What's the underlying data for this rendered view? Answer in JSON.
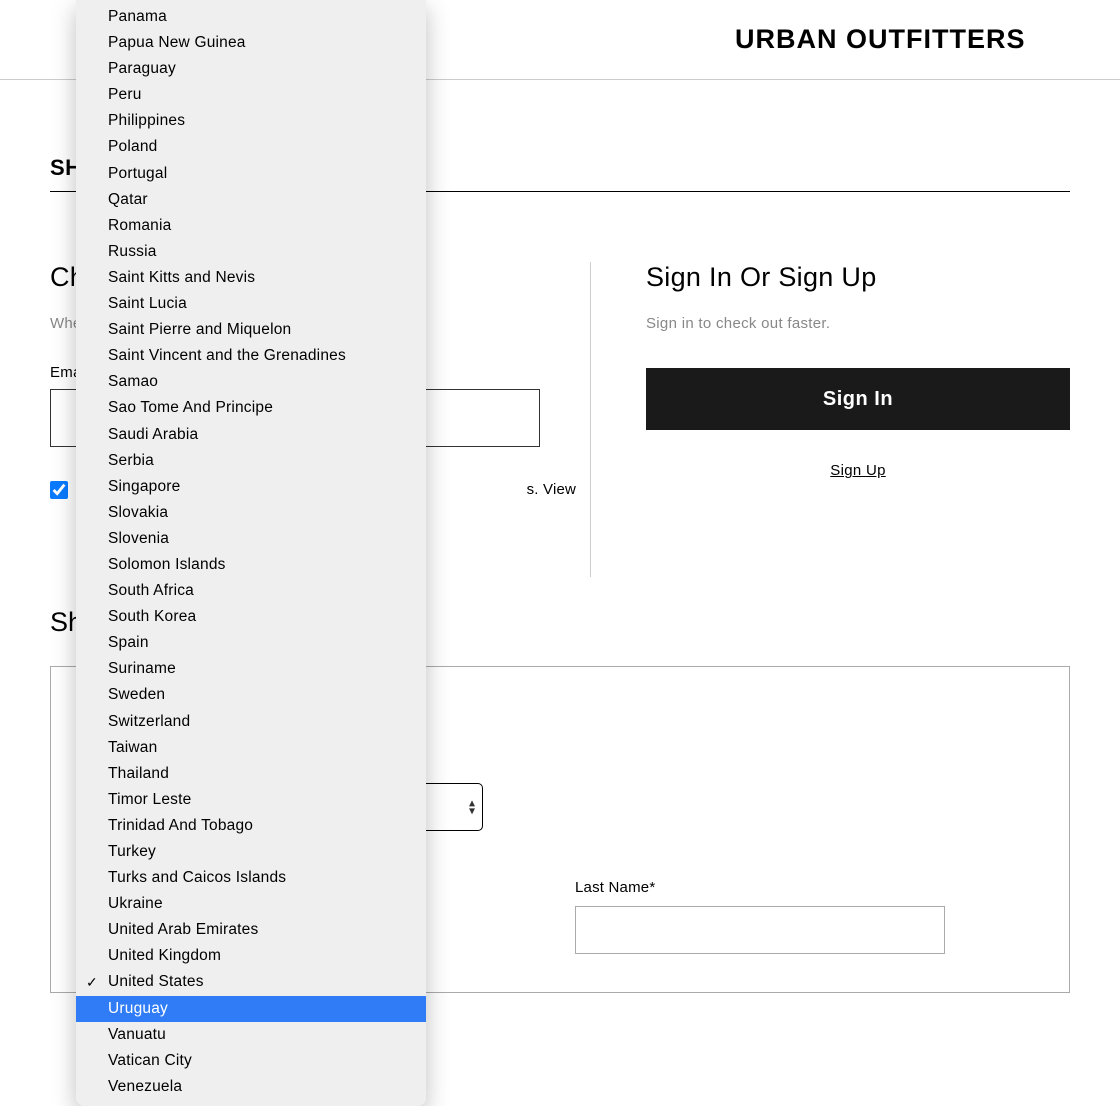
{
  "header": {
    "logo_text": "URBAN OUTFITTERS"
  },
  "section_top_title_fragment": "SH",
  "checkout": {
    "heading_fragment": "Ch",
    "subtext_fragment": "Whe",
    "email_label_fragment": "Ema",
    "checkbox_text_fragment": "s. View our"
  },
  "shipping": {
    "heading_fragment": "Sh",
    "last_name_label": "Last Name*"
  },
  "signin": {
    "heading": "Sign In Or Sign Up",
    "subtext": "Sign in to check out faster.",
    "button_label": "Sign In",
    "signup_label": "Sign Up"
  },
  "dropdown": {
    "options": [
      {
        "label": "Panama"
      },
      {
        "label": "Papua New Guinea"
      },
      {
        "label": "Paraguay"
      },
      {
        "label": "Peru"
      },
      {
        "label": "Philippines"
      },
      {
        "label": "Poland"
      },
      {
        "label": "Portugal"
      },
      {
        "label": "Qatar"
      },
      {
        "label": "Romania"
      },
      {
        "label": "Russia"
      },
      {
        "label": "Saint Kitts and Nevis"
      },
      {
        "label": "Saint Lucia"
      },
      {
        "label": "Saint Pierre and Miquelon"
      },
      {
        "label": "Saint Vincent and the Grenadines"
      },
      {
        "label": "Samao"
      },
      {
        "label": "Sao Tome And Principe"
      },
      {
        "label": "Saudi Arabia"
      },
      {
        "label": "Serbia"
      },
      {
        "label": "Singapore"
      },
      {
        "label": "Slovakia"
      },
      {
        "label": "Slovenia"
      },
      {
        "label": "Solomon Islands"
      },
      {
        "label": "South Africa"
      },
      {
        "label": "South Korea"
      },
      {
        "label": "Spain"
      },
      {
        "label": "Suriname"
      },
      {
        "label": "Sweden"
      },
      {
        "label": "Switzerland"
      },
      {
        "label": "Taiwan"
      },
      {
        "label": "Thailand"
      },
      {
        "label": "Timor Leste"
      },
      {
        "label": "Trinidad And Tobago"
      },
      {
        "label": "Turkey"
      },
      {
        "label": "Turks and Caicos Islands"
      },
      {
        "label": "Ukraine"
      },
      {
        "label": "United Arab Emirates"
      },
      {
        "label": "United Kingdom"
      },
      {
        "label": "United States",
        "checked": true
      },
      {
        "label": "Uruguay",
        "highlighted": true
      },
      {
        "label": "Vanuatu"
      },
      {
        "label": "Vatican City"
      },
      {
        "label": "Venezuela"
      }
    ]
  }
}
